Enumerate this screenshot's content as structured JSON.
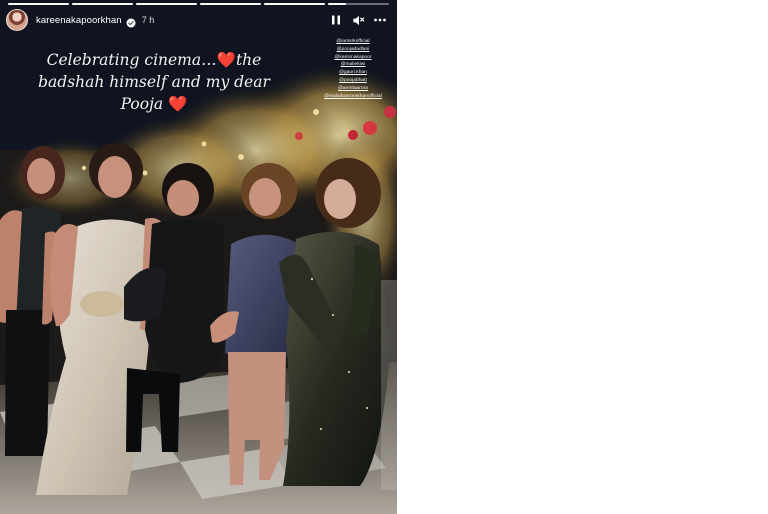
{
  "story": {
    "username": "kareenakapoorkhan",
    "time": "7 h",
    "progress_segments": [
      100,
      100,
      100,
      100,
      100,
      30
    ],
    "caption": {
      "line1": "Celebrating cinema…",
      "heart1": "❤️",
      "line1b": "the",
      "line2": "badshah himself and my dear",
      "line3": "Pooja",
      "heart2": "❤️"
    },
    "mentions": [
      "@iamsrkofficial",
      "@poojadadlani",
      "@karismakapoor",
      "@maliekiwi",
      "@gauri.khan",
      "@poojabhatt",
      "@amritaarora",
      "@malaikaarorakhanofficial"
    ],
    "controls": {
      "pause_icon": "pause-icon",
      "mute_icon": "mute-icon",
      "more_icon": "more-icon"
    },
    "accent": "#ef1f3e"
  }
}
